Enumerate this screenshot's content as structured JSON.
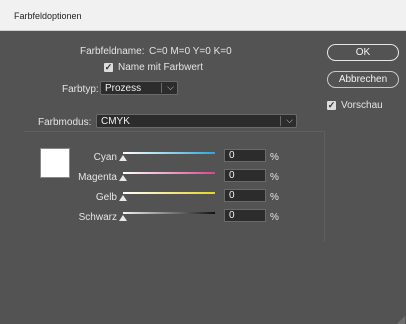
{
  "window": {
    "title": "Farbfeldoptionen"
  },
  "swatch_name": {
    "label": "Farbfeldname:",
    "value": "C=0 M=0 Y=0 K=0"
  },
  "name_with_value": {
    "checked": true,
    "label": "Name mit Farbwert"
  },
  "color_type": {
    "label": "Farbtyp:",
    "value": "Prozess"
  },
  "color_mode": {
    "label": "Farbmodus:",
    "value": "CMYK"
  },
  "buttons": {
    "ok": "OK",
    "cancel": "Abbrechen"
  },
  "preview": {
    "checked": true,
    "label": "Vorschau"
  },
  "swatch_color": "#ffffff",
  "sliders": [
    {
      "label": "Cyan",
      "value": "0",
      "unit": "%",
      "level": 0,
      "color": "#2aa7d8"
    },
    {
      "label": "Magenta",
      "value": "0",
      "unit": "%",
      "level": 0,
      "color": "#d9468f"
    },
    {
      "label": "Gelb",
      "value": "0",
      "unit": "%",
      "level": 0,
      "color": "#e5d520"
    },
    {
      "label": "Schwarz",
      "value": "0",
      "unit": "%",
      "level": 0,
      "color": "#111111"
    }
  ]
}
